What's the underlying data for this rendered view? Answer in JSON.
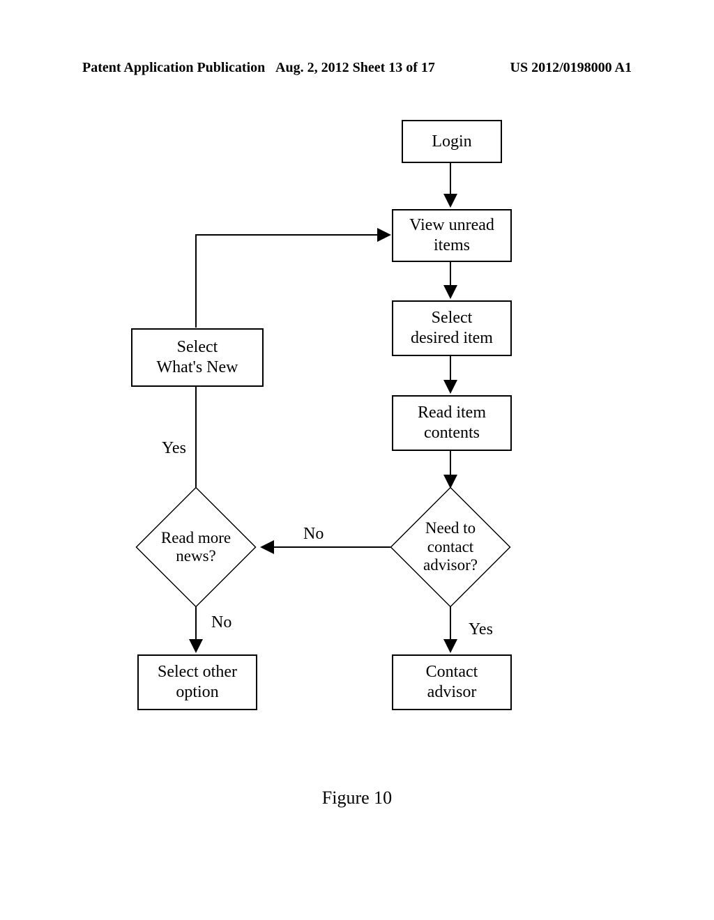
{
  "header": {
    "left": "Patent Application Publication",
    "center": "Aug. 2, 2012  Sheet 13 of 17",
    "right": "US 2012/0198000 A1"
  },
  "nodes": {
    "login": "Login",
    "view_unread": "View unread\nitems",
    "select_item": "Select\ndesired item",
    "read_contents": "Read item\ncontents",
    "need_contact": "Need to\ncontact\nadvisor?",
    "contact_advisor": "Contact\nadvisor",
    "read_more": "Read more\nnews?",
    "select_other": "Select other\noption",
    "select_whats_new": "Select\nWhat's New"
  },
  "labels": {
    "yes_left": "Yes",
    "no_mid": "No",
    "no_below": "No",
    "yes_right": "Yes"
  },
  "caption": "Figure 10"
}
